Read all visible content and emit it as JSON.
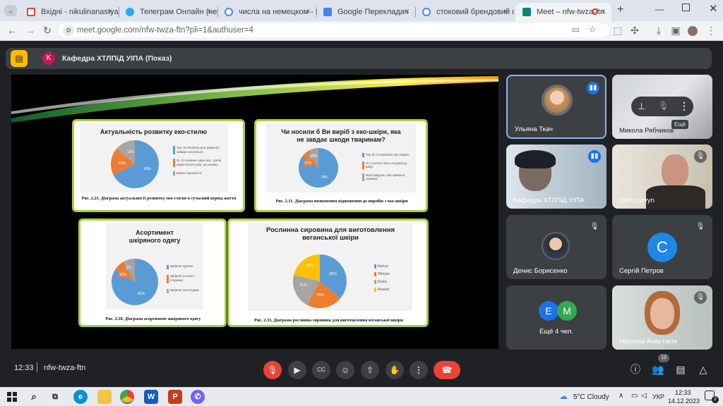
{
  "browser": {
    "tabs": [
      {
        "title": "Вхідні - nikulinanastya3@",
        "icon_color": "#ea4335",
        "icon": "gmail-icon"
      },
      {
        "title": "Телеграм Онлайн (неофі",
        "icon_color": "#2aabee",
        "icon": "telegram-icon"
      },
      {
        "title": "числа на немецком - По",
        "icon_color": "#4285f4",
        "icon": "google-icon"
      },
      {
        "title": "Google Перекладач",
        "icon_color": "#4285f4",
        "icon": "translate-icon"
      },
      {
        "title": "стоковий брендовий од",
        "icon_color": "#4285f4",
        "icon": "google-icon"
      },
      {
        "title": "Meet – nfw-twza-ftn",
        "icon_color": "#00897b",
        "icon": "meet-icon"
      }
    ],
    "new_tab": "+",
    "url": "meet.google.com/nfw-twza-ftn?pli=1&authuser=4"
  },
  "meet": {
    "presenter_initial": "K",
    "presentation_title": "Кафедра ХТЛПіД УІПА (Показ)",
    "slide": {
      "panel1_title": "Актуальність розвитку еко-стилю",
      "panel1_slices": [
        "65%",
        "23%",
        "12%"
      ],
      "panel1_legend": [
        "Так, бо безпека для довкілля завжди актуальна",
        "Ні, бо живемо один раз, треба користатися усім, що маємо",
        "Важко відповісти"
      ],
      "panel1_caption": "Рис. 2.23. Діаграма актуальності розвитку еко-стилю в сучасний період життя",
      "panel2_title": "Чи носили б Ви виріб з еко-шкіри, яка не завдає шкоди тваринам?",
      "panel2_slices": [
        "79%",
        "11%",
        "10%"
      ],
      "panel2_legend": [
        "Так, бо я полюбляю про тварин",
        "Ні, я носити лише натуральну шкіру",
        "Мені байдуже, аби прийшли справжні"
      ],
      "panel2_caption": "Рис. 2.31. Діаграма визначення відношення до виробів з еко-шкіри",
      "panel3_title": "Асортимент шкіряного одягу",
      "panel3_slices": [
        "81%",
        "10%",
        "9%"
      ],
      "panel3_legend": [
        "Шкіряні куртки",
        "Шкіряні штани / спідниці",
        "Шкіряні аксесуари"
      ],
      "panel3_caption": "Рис. 2.30. Діаграма асортимент шкіряного одягу",
      "panel4_title": "Рослинна сировина для виготовлення веганської шкіри",
      "panel4_slices": [
        "36%",
        "25%",
        "21%",
        "28%"
      ],
      "panel4_legend": [
        "Кактус",
        "Яблуко",
        "Кокос",
        "Ананас"
      ],
      "panel4_caption": "Рис. 2.33. Діаграма рослинна сировина для виготовлення веганської шкіри"
    },
    "participants": [
      {
        "name": "Ульяна Ткач",
        "speaking": true
      },
      {
        "name": "Микола Рябчиков",
        "muted": false
      },
      {
        "name": "Кафедра ХТЛПіД УІПА",
        "speaking": true
      },
      {
        "name": "Oleh Lytvyn",
        "muted": true
      },
      {
        "name": "Денис Борисенко",
        "muted": true
      },
      {
        "name": "Сергій Петров",
        "initial": "С",
        "muted": true
      },
      {
        "name": "Ещё 4 чел.",
        "initials": [
          "E",
          "M"
        ]
      },
      {
        "name": "Нікуліна Анастасія",
        "muted": true
      }
    ],
    "tooltip": "Ещё",
    "time": "12:33",
    "meeting_code": "nfw-twza-ftn",
    "people_count": "12"
  },
  "taskbar": {
    "weather": "5°C  Cloudy",
    "lang": "УКР",
    "time": "12:33",
    "date": "14.12.2023",
    "notifications": "2"
  }
}
